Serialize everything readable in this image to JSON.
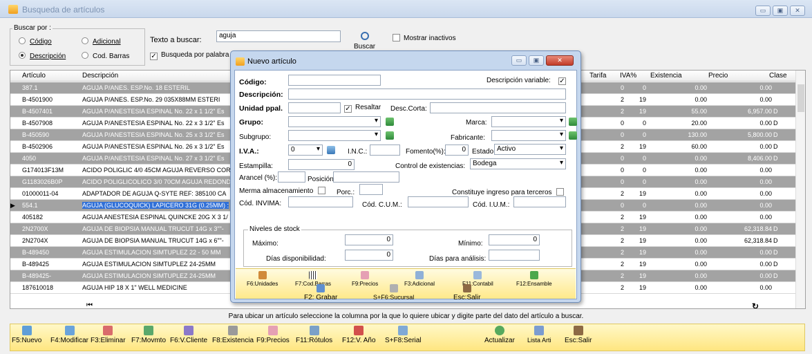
{
  "window": {
    "title": "Busqueda de artículos"
  },
  "search": {
    "group_label": "Buscar por :",
    "opt_codigo": "Código",
    "opt_adicional": "Adicional",
    "opt_descripcion": "Descripción",
    "opt_codbarras": "Cod. Barras",
    "selected": "Descripción",
    "text_label": "Texto a buscar:",
    "text_value": "aguja",
    "buscar_label": "Buscar",
    "mostrar_inactivos": "Mostrar inactivos",
    "busqueda_palabra": "Busqueda por palabra"
  },
  "grid": {
    "headers": {
      "articulo": "Artículo",
      "descripcion": "Descripción",
      "tarifa": "Tarifa",
      "iva": "IVA%",
      "existencia": "Existencia",
      "precio": "Precio",
      "clase": "Clase"
    },
    "rows": [
      {
        "art": "387.1",
        "desc": "AGUJA P/ANES. ESP.No. 18 ESTERIL",
        "tarifa": "0",
        "iva": "0",
        "exist": "0.00",
        "precio": "0.00",
        "clase": ""
      },
      {
        "art": "B-4501900",
        "desc": "AGUJA P/ANES. ESP.No. 29 035X88MM ESTERI",
        "tarifa": "2",
        "iva": "19",
        "exist": "0.00",
        "precio": "0.00",
        "clase": ""
      },
      {
        "art": "B-4507401",
        "desc": "AGUJA P/ANESTESIA ESPINAL No. 22 x 1 1/2\" Es",
        "tarifa": "2",
        "iva": "19",
        "exist": "55.00",
        "precio": "6,957.00",
        "clase": "D"
      },
      {
        "art": "B-4507908",
        "desc": "AGUJA P/ANESTESIA ESPINAL No. 22 x 3 1/2\" Es",
        "tarifa": "0",
        "iva": "0",
        "exist": "20.00",
        "precio": "0.00",
        "clase": "D"
      },
      {
        "art": "B-450590",
        "desc": "AGUJA P/ANESTESIA ESPINAL No. 25 x 3 1/2\" Es",
        "tarifa": "0",
        "iva": "0",
        "exist": "130.00",
        "precio": "5,800.00",
        "clase": "D"
      },
      {
        "art": "B-4502906",
        "desc": "AGUJA P/ANESTESIA ESPINAL No. 26 x 3 1/2\" Es",
        "tarifa": "2",
        "iva": "19",
        "exist": "60.00",
        "precio": "0.00",
        "clase": "D"
      },
      {
        "art": "4050",
        "desc": "AGUJA P/ANESTESIA ESPINAL No. 27 x 3 1/2\" Es",
        "tarifa": "0",
        "iva": "0",
        "exist": "0.00",
        "precio": "8,406.00",
        "clase": "D"
      },
      {
        "art": "G174013F13M",
        "desc": "ACIDO POLIGLIC 4/0 45CM AGUJA REVERSO COR",
        "tarifa": "0",
        "iva": "0",
        "exist": "0.00",
        "precio": "0.00",
        "clase": ""
      },
      {
        "art": "G1183026B0P",
        "desc": "ACIDO POLIGLICOLICO 3/0 70CM AGUJA REDOND",
        "tarifa": "0",
        "iva": "0",
        "exist": "0.00",
        "precio": "0.00",
        "clase": ""
      },
      {
        "art": "01000011-04",
        "desc": "ADAPTADOR DE AGUJA Q-SYTE REF: 385100  CA",
        "tarifa": "2",
        "iva": "19",
        "exist": "0.00",
        "precio": "0.00",
        "clase": ""
      },
      {
        "art": "554.1",
        "desc": "AGUJA (GLUCOQUICK) LAPICERO 31G (0.25MM) :",
        "tarifa": "0",
        "iva": "0",
        "exist": "0.00",
        "precio": "0.00",
        "clase": ""
      },
      {
        "art": "405182",
        "desc": "AGUJA ANESTESIA ESPINAL QUINCKE 20G X 3 1/",
        "tarifa": "2",
        "iva": "19",
        "exist": "0.00",
        "precio": "0.00",
        "clase": ""
      },
      {
        "art": "2N2700X",
        "desc": "AGUJA DE BIOPSIA MANUAL TRUCUT 14G x 3\"\"-",
        "tarifa": "2",
        "iva": "19",
        "exist": "0.00",
        "precio": "62,318.84",
        "clase": "D"
      },
      {
        "art": "2N2704X",
        "desc": "AGUJA DE BIOPSIA MANUAL TRUCUT 14G x 6\"\"-",
        "tarifa": "2",
        "iva": "19",
        "exist": "0.00",
        "precio": "62,318.84",
        "clase": "D"
      },
      {
        "art": "B-489450",
        "desc": "AGUJA ESTIMULACION SIMTUPLEZ 22 - 50 MM",
        "tarifa": "2",
        "iva": "19",
        "exist": "0.00",
        "precio": "0.00",
        "clase": "D"
      },
      {
        "art": "B-489425",
        "desc": "AGUJA ESTIMULACION SIMTUPLEZ 24-25MM",
        "tarifa": "2",
        "iva": "19",
        "exist": "0.00",
        "precio": "0.00",
        "clase": "D"
      },
      {
        "art": "B-489425-",
        "desc": "AGUJA ESTIMULACION SIMTUPLEZ 24-25MM",
        "tarifa": "2",
        "iva": "19",
        "exist": "0.00",
        "precio": "0.00",
        "clase": "D"
      },
      {
        "art": "187610018",
        "desc": "AGUJA HIP 18 X 1\" WELL MEDICINE",
        "tarifa": "2",
        "iva": "19",
        "exist": "0.00",
        "precio": "0.00",
        "clase": ""
      }
    ]
  },
  "status_text": "Para ubicar un artículo seleccione la columna por la que lo quiere ubicar y digite parte del dato del artículo a buscar.",
  "toolbar": [
    "F5:Nuevo",
    "F4:Modificar",
    "F3:Eliminar",
    "F7:Movmto",
    "F6:V.Cliente",
    "F8:Existencia",
    "F9:Precios",
    "F11:Rótulos",
    "F12:V. Año",
    "S+F8:Serial",
    "Actualizar",
    "Lista Arti",
    "Esc:Salir"
  ],
  "dialog": {
    "title": "Nuevo artículo",
    "codigo": "Código:",
    "desc_variable": "Descripción variable:",
    "descripcion": "Descripción:",
    "unidad": "Unidad ppal.",
    "resaltar": "Resaltar",
    "desc_corta": "Desc.Corta:",
    "grupo": "Grupo:",
    "marca": "Marca:",
    "subgrupo": "Subgrupo:",
    "fabricante": "Fabricante:",
    "iva": "I.V.A.:",
    "iva_value": "0",
    "inc": "I.N.C.:",
    "fomento": "Fomento(%):",
    "fomento_value": "0",
    "estado": "Estado:",
    "estado_value": "Activo",
    "estampilla": "Estampilla:",
    "estampilla_value": "0",
    "control": "Control de existencias:",
    "control_value": "Bodega",
    "arancel": "Arancel (%):",
    "posicion": "Posición:",
    "merma": "Merma almacenamiento",
    "porc": "Porc.:",
    "ingreso": "Constituye ingreso para terceros",
    "invima": "Cód. INVIMA:",
    "cum": "Cód. C.U.M.:",
    "ium": "Cód. I.U.M.:",
    "stock_legend": "Niveles de stock",
    "maximo": "Máximo:",
    "maximo_value": "0",
    "minimo": "Mínimo:",
    "minimo_value": "0",
    "dias_disp": "Días disponibilidad:",
    "dias_disp_value": "0",
    "dias_analisis": "Días para análisis:",
    "toolbar": [
      "F6:Unidades",
      "F7:Cod.Barras",
      "F9:Precios",
      "F3:Adicional",
      "F11:Contabil",
      "F12:Ensamble"
    ],
    "bottom": [
      "F2: Grabar",
      "S+F6:Sucursal",
      "Esc:Salir"
    ]
  }
}
